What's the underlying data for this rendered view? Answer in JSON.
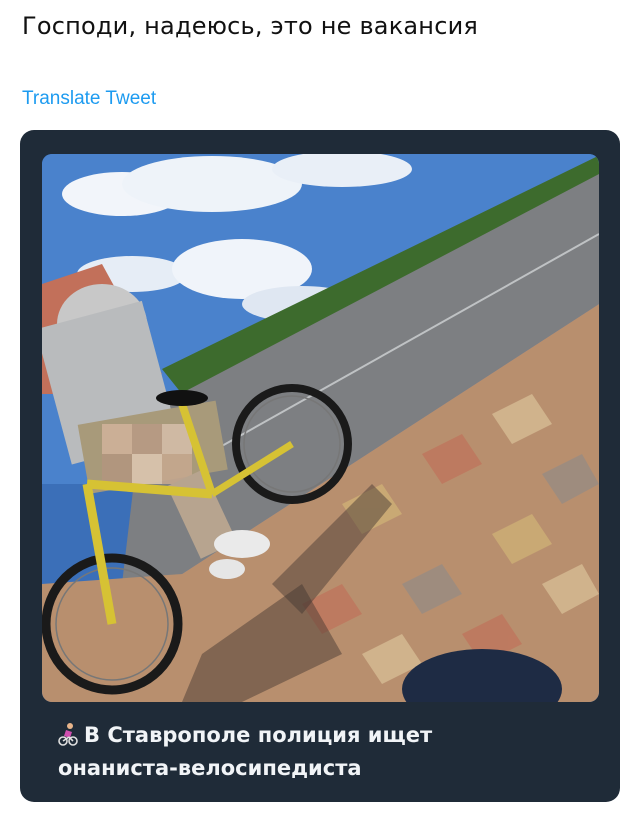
{
  "tweet": {
    "text": "Господи, надеюсь, это не вакансия",
    "translate_label": "Translate Tweet"
  },
  "post": {
    "caption_line1": "В Ставрополе полиция ищет",
    "caption_line2": "онаниста-велосипедиста",
    "caption_icon": "cyclist-icon",
    "photo_alt": "photo-cyclist-on-sidewalk"
  },
  "colors": {
    "card_bg": "#1f2b38",
    "link": "#1d9bf0",
    "caption_text": "#f1f4f7"
  }
}
